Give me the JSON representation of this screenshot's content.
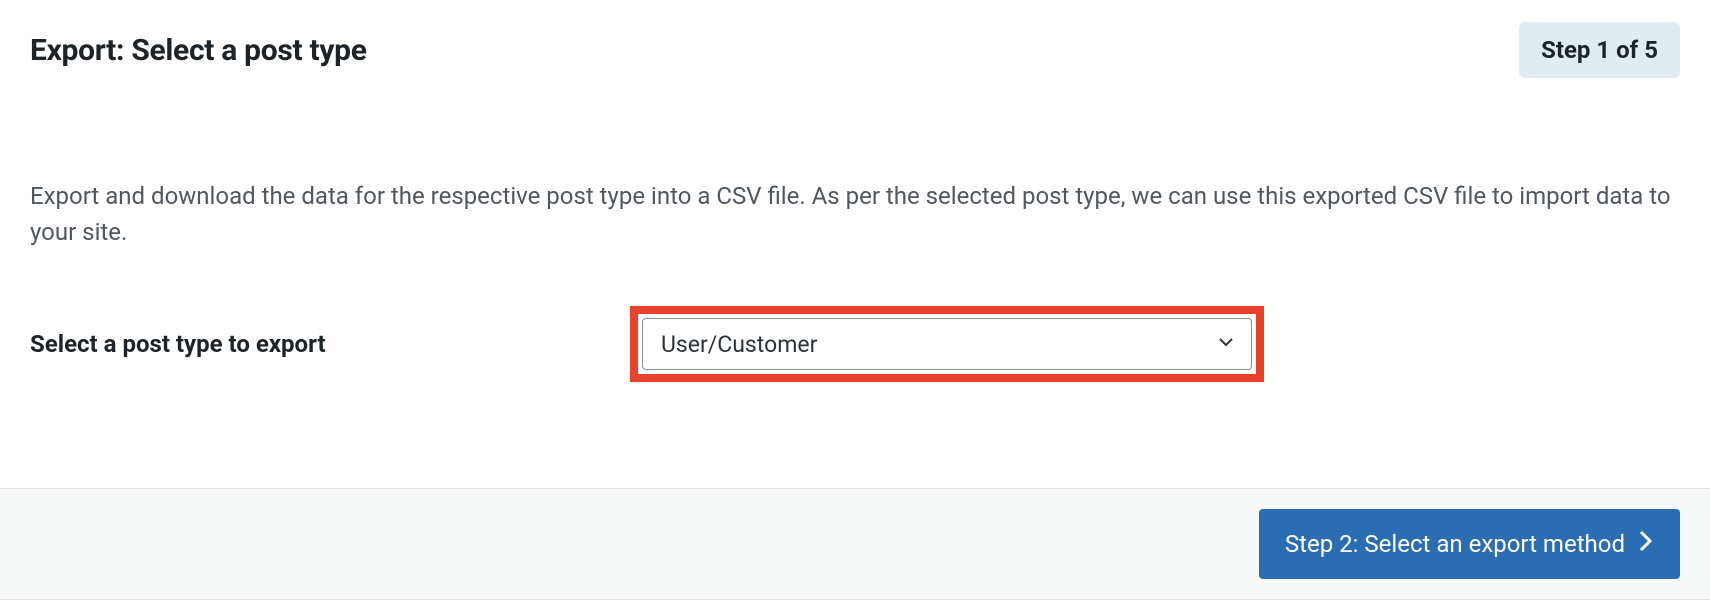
{
  "header": {
    "title": "Export: Select a post type",
    "step_badge": "Step 1 of 5"
  },
  "main": {
    "description": "Export and download the data for the respective post type into a CSV file. As per the selected post type, we can use this exported CSV file to import data to your site.",
    "form_label": "Select a post type to export",
    "select_value": "User/Customer"
  },
  "footer": {
    "next_button": "Step 2: Select an export method"
  }
}
